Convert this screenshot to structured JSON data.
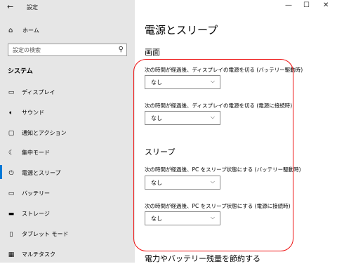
{
  "window": {
    "title": "設定",
    "minimize": "—",
    "maximize": "☐",
    "close": "✕",
    "back": "←"
  },
  "sidebar": {
    "home": "ホーム",
    "search_placeholder": "設定の検索",
    "section_title": "システム",
    "items": [
      {
        "label": "ディスプレイ",
        "icon": "display-icon"
      },
      {
        "label": "サウンド",
        "icon": "speaker-icon"
      },
      {
        "label": "通知とアクション",
        "icon": "notification-icon"
      },
      {
        "label": "集中モード",
        "icon": "moon-icon"
      },
      {
        "label": "電源とスリープ",
        "icon": "power-icon"
      },
      {
        "label": "バッテリー",
        "icon": "battery-icon"
      },
      {
        "label": "ストレージ",
        "icon": "storage-icon"
      },
      {
        "label": "タブレット モード",
        "icon": "tablet-icon"
      },
      {
        "label": "マルチタスク",
        "icon": "multitask-icon"
      }
    ]
  },
  "main": {
    "title": "電源とスリープ",
    "screen_heading": "画面",
    "screen_battery_label": "次の時間が経過後、ディスプレイの電源を切る (バッテリー駆動時)",
    "screen_battery_value": "なし",
    "screen_plugged_label": "次の時間が経過後、ディスプレイの電源を切る (電源に接続時)",
    "screen_plugged_value": "なし",
    "sleep_heading": "スリープ",
    "sleep_battery_label": "次の時間が経過後、PC をスリープ状態にする (バッテリー駆動時)",
    "sleep_battery_value": "なし",
    "sleep_plugged_label": "次の時間が経過後、PC をスリープ状態にする (電源に接続時)",
    "sleep_plugged_value": "なし",
    "bottom_heading": "電力やバッテリー残量を節約する"
  },
  "colors": {
    "accent": "#0078d7",
    "annotation": "#e11111"
  }
}
